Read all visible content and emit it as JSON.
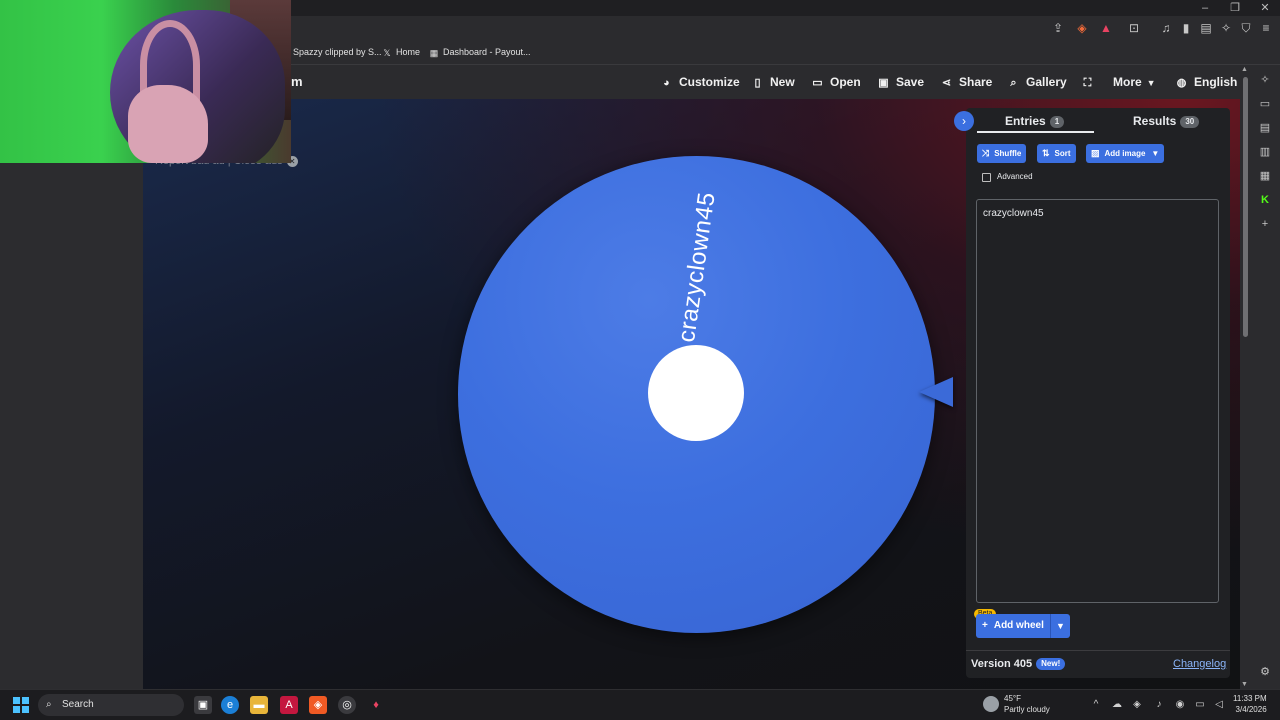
{
  "browser": {
    "bookmarks": [
      {
        "label": "Spazzy clipped by S...",
        "icon": "clip-icon"
      },
      {
        "label": "Home",
        "icon": "x-logo-icon"
      },
      {
        "label": "Dashboard - Payout...",
        "icon": "dashboard-icon"
      }
    ]
  },
  "site": {
    "logo_fragment": "m",
    "nav": {
      "customize": "Customize",
      "new": "New",
      "open": "Open",
      "save": "Save",
      "share": "Share",
      "gallery": "Gallery",
      "more": "More",
      "language": "English"
    },
    "ad_text": "Report bad ad  |   Close ads"
  },
  "wheel": {
    "entries": [
      "crazyclown45"
    ],
    "color": "#3d6fdf",
    "pointer_color": "#3b6ad8"
  },
  "panel": {
    "tabs": [
      {
        "label": "Entries",
        "count": "1"
      },
      {
        "label": "Results",
        "count": "30"
      }
    ],
    "buttons": {
      "shuffle": "Shuffle",
      "sort": "Sort",
      "add_image": "Add image"
    },
    "advanced_label": "Advanced",
    "entries_text": "crazyclown45",
    "beta_badge": "Beta",
    "add_wheel": "Add wheel",
    "version": "Version 405",
    "new_badge": "New!",
    "changelog": "Changelog"
  },
  "taskbar": {
    "search_label": "Search",
    "weather_temp": "45°F",
    "weather_desc": "Partly cloudy",
    "time": "11:33 PM",
    "date": "3/4/2026"
  },
  "colors": {
    "accent": "#3b6fe0",
    "beta": "#f5b800",
    "link": "#8ab4f8"
  }
}
